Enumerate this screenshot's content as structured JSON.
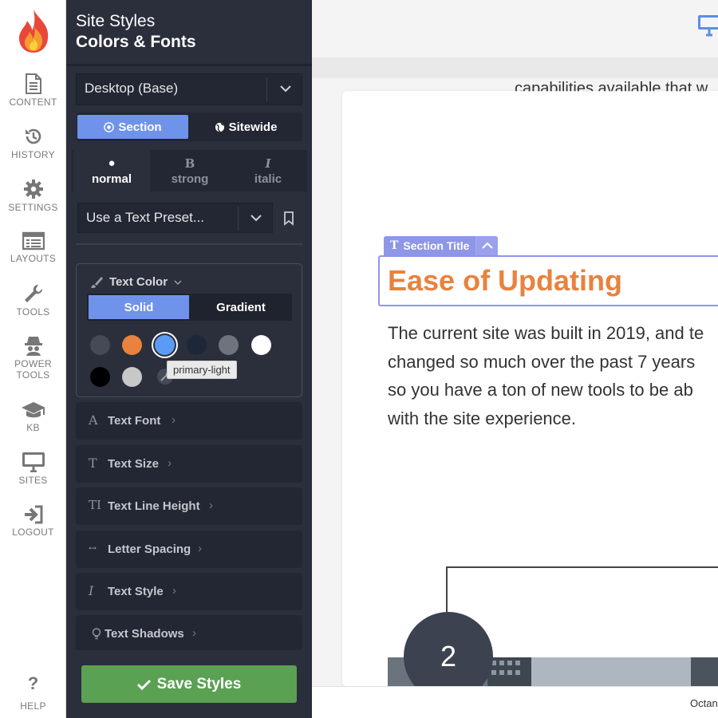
{
  "sidebar": {
    "items": [
      {
        "label": "CONTENT",
        "icon": "document-icon"
      },
      {
        "label": "HISTORY",
        "icon": "history-icon"
      },
      {
        "label": "SETTINGS",
        "icon": "gear-icon"
      },
      {
        "label": "LAYOUTS",
        "icon": "layouts-icon"
      },
      {
        "label": "TOOLS",
        "icon": "wrench-icon"
      },
      {
        "label": "POWER\nTOOLS",
        "label_line1": "POWER",
        "label_line2": "TOOLS",
        "icon": "spy-icon"
      },
      {
        "label": "KB",
        "icon": "graduation-cap-icon"
      },
      {
        "label": "SITES",
        "icon": "monitor-icon"
      },
      {
        "label": "LOGOUT",
        "icon": "logout-icon"
      }
    ],
    "help": {
      "label": "HELP",
      "icon": "question-icon"
    }
  },
  "panel": {
    "title": "Site Styles",
    "subtitle": "Colors & Fonts",
    "device_select": "Desktop (Base)",
    "scope_tabs": [
      {
        "label": "Section",
        "active": true
      },
      {
        "label": "Sitewide",
        "active": false
      }
    ],
    "text_tabs": [
      {
        "icon": "●",
        "label": "normal",
        "active": true
      },
      {
        "icon": "B",
        "label": "strong",
        "active": false
      },
      {
        "icon": "I",
        "label": "italic",
        "active": false
      }
    ],
    "preset_select": "Use a Text Preset...",
    "text_color": {
      "title": "Text Color",
      "modes": [
        {
          "label": "Solid",
          "active": true
        },
        {
          "label": "Gradient",
          "active": false
        }
      ],
      "swatches": [
        "#454a56",
        "#e8823e",
        "#5b9bf5",
        "#1e2738",
        "#6e737d",
        "#ffffff",
        "#000000",
        "#c8c8c8"
      ],
      "selected_swatch": 2,
      "tooltip": "primary-light"
    },
    "rows": [
      {
        "label": "Text Font",
        "icon": "A"
      },
      {
        "label": "Text Size",
        "icon": "T"
      },
      {
        "label": "Text Line Height",
        "icon": "TI"
      },
      {
        "label": "Letter Spacing",
        "icon": "↔"
      },
      {
        "label": "Text Style",
        "icon": "I"
      },
      {
        "label": "Text Shadows",
        "icon": "💡"
      }
    ],
    "save_label": "Save Styles"
  },
  "preview": {
    "cut_text": "capabilities available that w",
    "badge_label": "Section Title",
    "heading": "Ease of Updating",
    "body_lines": [
      "The current site was built in 2019, and te",
      "changed so much over the past 7 years",
      "so you have a ton of new tools to be ab",
      "with the site experience."
    ],
    "step_number": "2",
    "footer_text": "Octane",
    "colors": {
      "accent": "#e8823e",
      "select": "#8e96e8"
    }
  }
}
